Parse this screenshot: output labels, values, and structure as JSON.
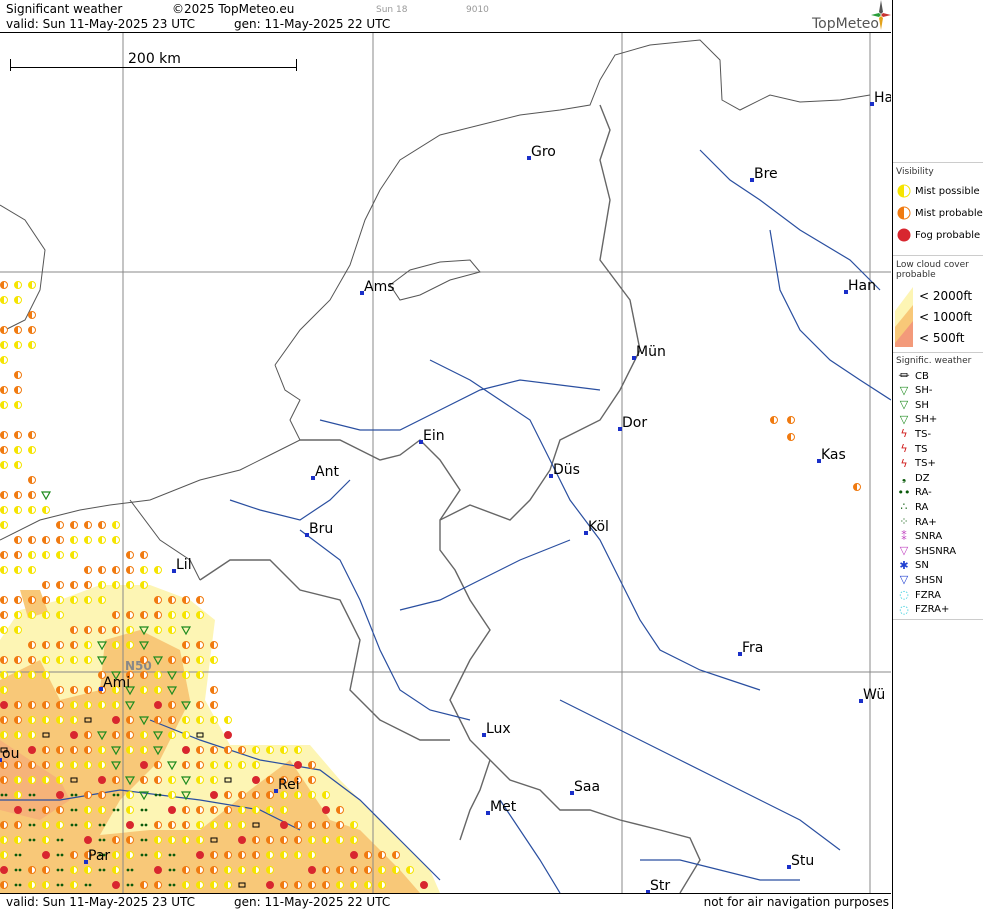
{
  "header": {
    "title": "Significant weather",
    "copyright": "©2025 TopMeteo.eu",
    "valid": "valid:  Sun  11-May-2025  23 UTC",
    "generated": "gen: 11-May-2025 22 UTC",
    "small_1": "Sun 18",
    "small_2": "9010",
    "brand": "TopMeteo"
  },
  "scale_bar": {
    "label": "200 km"
  },
  "map": {
    "cities": [
      {
        "name": "Gro"
      },
      {
        "name": "Bre"
      },
      {
        "name": "Ha"
      },
      {
        "name": "Ams"
      },
      {
        "name": "Han"
      },
      {
        "name": "Mün"
      },
      {
        "name": "Dor"
      },
      {
        "name": "Ein"
      },
      {
        "name": "Ant"
      },
      {
        "name": "Düs"
      },
      {
        "name": "Kas"
      },
      {
        "name": "Bru"
      },
      {
        "name": "Köl"
      },
      {
        "name": "Lil"
      },
      {
        "name": "Fra"
      },
      {
        "name": "Ami"
      },
      {
        "name": "Wü"
      },
      {
        "name": "Lux"
      },
      {
        "name": "Rei"
      },
      {
        "name": "Saa"
      },
      {
        "name": "ou"
      },
      {
        "name": "Met"
      },
      {
        "name": "Stu"
      },
      {
        "name": "Par"
      },
      {
        "name": "Str"
      }
    ],
    "grid_label": "N50"
  },
  "legend": {
    "visibility_title": "Visibility",
    "visibility_items": [
      {
        "label": "Mist possible",
        "color": "#f5e400"
      },
      {
        "label": "Mist probable",
        "color": "#f07a10"
      },
      {
        "label": "Fog probable",
        "color": "#d8262f"
      }
    ],
    "cloud_title_1": "Low cloud cover",
    "cloud_title_2": "probable",
    "cloud_items": [
      {
        "label": "< 2000ft",
        "color": "#fdf5b4"
      },
      {
        "label": "< 1000ft",
        "color": "#f8c878"
      },
      {
        "label": "<   500ft",
        "color": "#f39a7a"
      }
    ],
    "sigwx_title": "Signific. weather",
    "sigwx_items": [
      {
        "label": "CB",
        "icon": "cb-icon",
        "glyph": "⏛",
        "color": "#000"
      },
      {
        "label": "SH-",
        "icon": "shower-light-icon",
        "glyph": "▽",
        "color": "#1e8b1e"
      },
      {
        "label": "SH",
        "icon": "shower-icon",
        "glyph": "▽",
        "color": "#1e8b1e"
      },
      {
        "label": "SH+",
        "icon": "shower-heavy-icon",
        "glyph": "▽",
        "color": "#1e8b1e"
      },
      {
        "label": "TS-",
        "icon": "thunderstorm-light-icon",
        "glyph": "ϟ",
        "color": "#d01818"
      },
      {
        "label": "TS",
        "icon": "thunderstorm-icon",
        "glyph": "ϟ",
        "color": "#d01818"
      },
      {
        "label": "TS+",
        "icon": "thunderstorm-heavy-icon",
        "glyph": "ϟ",
        "color": "#d01818"
      },
      {
        "label": "DZ",
        "icon": "drizzle-icon",
        "glyph": "❟",
        "color": "#0a5a0a"
      },
      {
        "label": "RA-",
        "icon": "rain-light-icon",
        "glyph": "••",
        "color": "#0a5a0a"
      },
      {
        "label": "RA",
        "icon": "rain-icon",
        "glyph": "∴",
        "color": "#0a5a0a"
      },
      {
        "label": "RA+",
        "icon": "rain-heavy-icon",
        "glyph": "⁘",
        "color": "#0a5a0a"
      },
      {
        "label": "SNRA",
        "icon": "snow-rain-icon",
        "glyph": "⁑",
        "color": "#c040c0"
      },
      {
        "label": "SHSNRA",
        "icon": "snow-rain-shower-icon",
        "glyph": "▽",
        "color": "#c040c0"
      },
      {
        "label": "SN",
        "icon": "snow-icon",
        "glyph": "✱",
        "color": "#2040d0"
      },
      {
        "label": "SHSN",
        "icon": "snow-shower-icon",
        "glyph": "▽",
        "color": "#2040d0"
      },
      {
        "label": "FZRA",
        "icon": "freezing-rain-icon",
        "glyph": "◌",
        "color": "#20c8d8"
      },
      {
        "label": "FZRA+",
        "icon": "freezing-rain-heavy-icon",
        "glyph": "◌",
        "color": "#20c8d8"
      }
    ]
  },
  "footer": {
    "valid": "valid:  Sun  11-May-2025  23 UTC",
    "generated": "gen: 11-May-2025 22 UTC",
    "disclaimer": "not for air navigation purposes"
  },
  "colors": {
    "river": "#2a4fa0",
    "border": "#555555",
    "grid": "#888888",
    "mist_possible": "#f5e400",
    "mist_probable": "#f07a10",
    "fog": "#d8262f",
    "cloud_2000": "#fdf5b4",
    "cloud_1000": "#f8c878",
    "cloud_500": "#f39a7a"
  }
}
